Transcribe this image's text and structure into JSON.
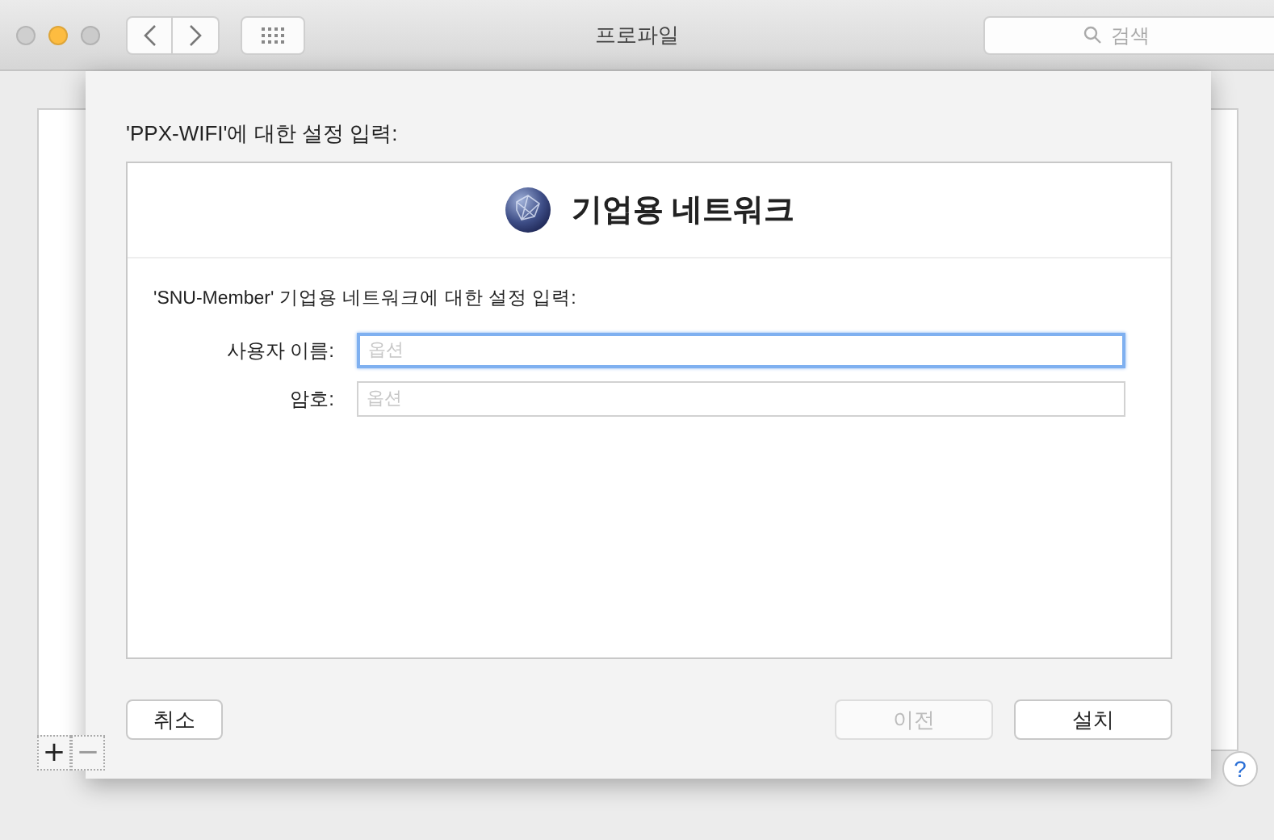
{
  "window": {
    "title": "프로파일",
    "traffic_lights": [
      {
        "kind": "close",
        "on": false
      },
      {
        "kind": "minimize",
        "on": true
      },
      {
        "kind": "zoom",
        "on": false
      }
    ],
    "search": {
      "placeholder": "검색"
    }
  },
  "sheet": {
    "heading": "'PPX-WIFI'에 대한 설정 입력:",
    "panel_title": "기업용 네트워크",
    "description": "'SNU-Member' 기업용 네트워크에 대한 설정 입력:",
    "fields": [
      {
        "label": "사용자 이름:",
        "placeholder": "옵션",
        "focused": true
      },
      {
        "label": "암호:",
        "placeholder": "옵션",
        "focused": false
      }
    ],
    "buttons": [
      {
        "label": "취소",
        "disabled": false
      },
      {
        "label": "이전",
        "disabled": true
      },
      {
        "label": "설치",
        "disabled": false
      }
    ]
  },
  "list_controls": [
    {
      "label": "+",
      "disabled": false
    },
    {
      "label": "−",
      "disabled": true
    }
  ],
  "help": "?"
}
